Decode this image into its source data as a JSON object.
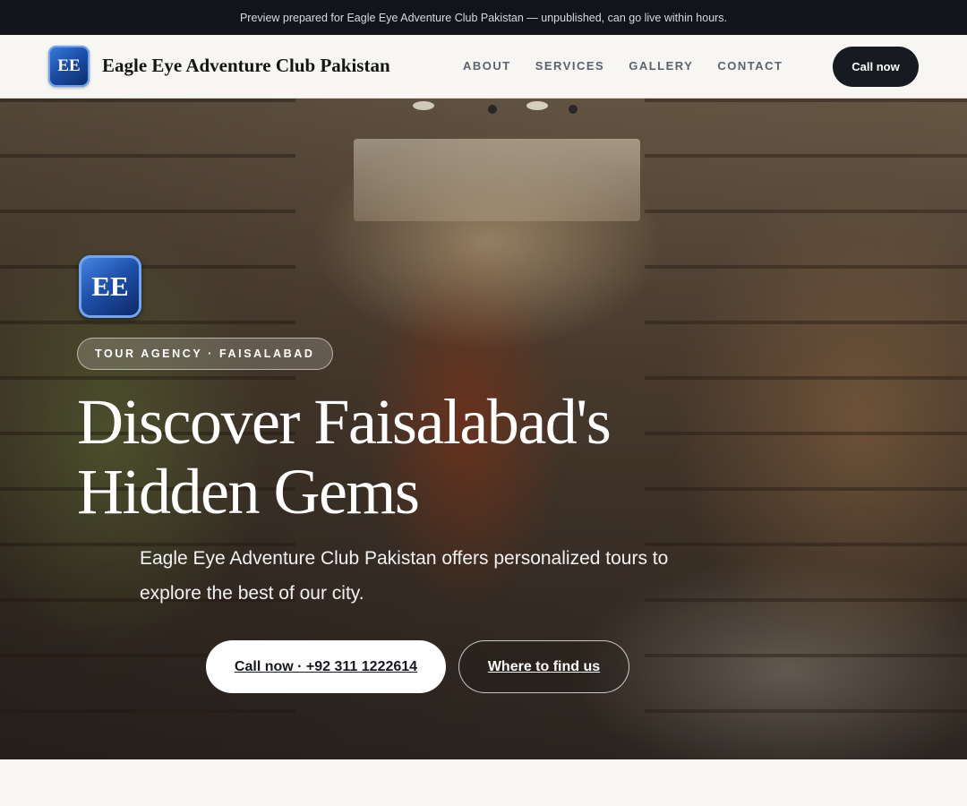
{
  "banner": {
    "text": "Preview prepared for Eagle Eye Adventure Club Pakistan — unpublished, can go live within hours."
  },
  "header": {
    "logo_text": "EE",
    "brand_name": "Eagle Eye Adventure Club Pakistan",
    "nav": [
      {
        "label": "ABOUT"
      },
      {
        "label": "SERVICES"
      },
      {
        "label": "GALLERY"
      },
      {
        "label": "CONTACT"
      }
    ],
    "cta_label": "Call now"
  },
  "hero": {
    "logo_text": "EE",
    "eyebrow": "TOUR AGENCY · FAISALABAD",
    "headline": "Discover Faisalabad's Hidden Gems",
    "subtext": "Eagle Eye Adventure Club Pakistan offers personalized tours to explore the best of our city.",
    "primary_button": "Call now · +92 311 1222614",
    "secondary_button": "Where to find us",
    "background_image": "spice-shop-interior-photo"
  },
  "colors": {
    "banner_bg": "#11151b",
    "header_bg": "#f7f6f3",
    "dark_button": "#171a20",
    "logo_blue": "#1f52ad",
    "page_bg": "#f8f7f4"
  }
}
